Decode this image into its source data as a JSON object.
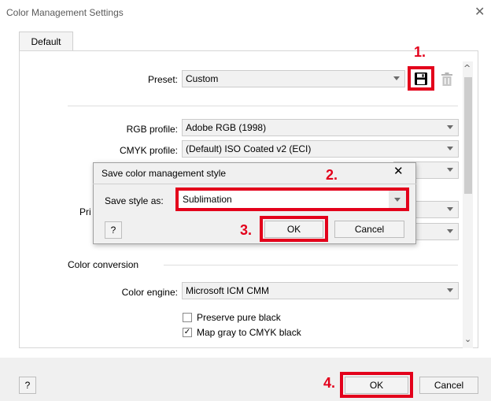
{
  "window": {
    "title": "Color Management Settings",
    "close_glyph": "✕"
  },
  "tabs": [
    {
      "label": "Default"
    }
  ],
  "preset": {
    "label": "Preset:",
    "value": "Custom",
    "save_icon": "save-icon",
    "delete_icon": "trash-icon"
  },
  "profiles": {
    "rgb": {
      "label": "RGB profile:",
      "value": "Adobe RGB (1998)"
    },
    "cmyk": {
      "label": "CMYK profile:",
      "value": "(Default) ISO Coated v2 (ECI)"
    },
    "partial_label": "Pri"
  },
  "conversion": {
    "heading": "Color conversion",
    "engine_label": "Color engine:",
    "engine_value": "Microsoft ICM CMM",
    "preserve_black": {
      "label": "Preserve pure black",
      "checked": false
    },
    "map_gray": {
      "label": "Map gray to CMYK black",
      "checked": true,
      "check_glyph": "✓"
    }
  },
  "save_dialog": {
    "title": "Save color management style",
    "close_glyph": "✕",
    "field_label": "Save style as:",
    "field_value": "Sublimation",
    "help_label": "?",
    "ok_label": "OK",
    "cancel_label": "Cancel"
  },
  "footer": {
    "help_label": "?",
    "ok_label": "OK",
    "cancel_label": "Cancel"
  },
  "annotations": {
    "step1": "1.",
    "step2": "2.",
    "step3": "3.",
    "step4": "4."
  },
  "colors": {
    "highlight": "#e3001b",
    "dialog_bg": "#f0f0f0"
  }
}
